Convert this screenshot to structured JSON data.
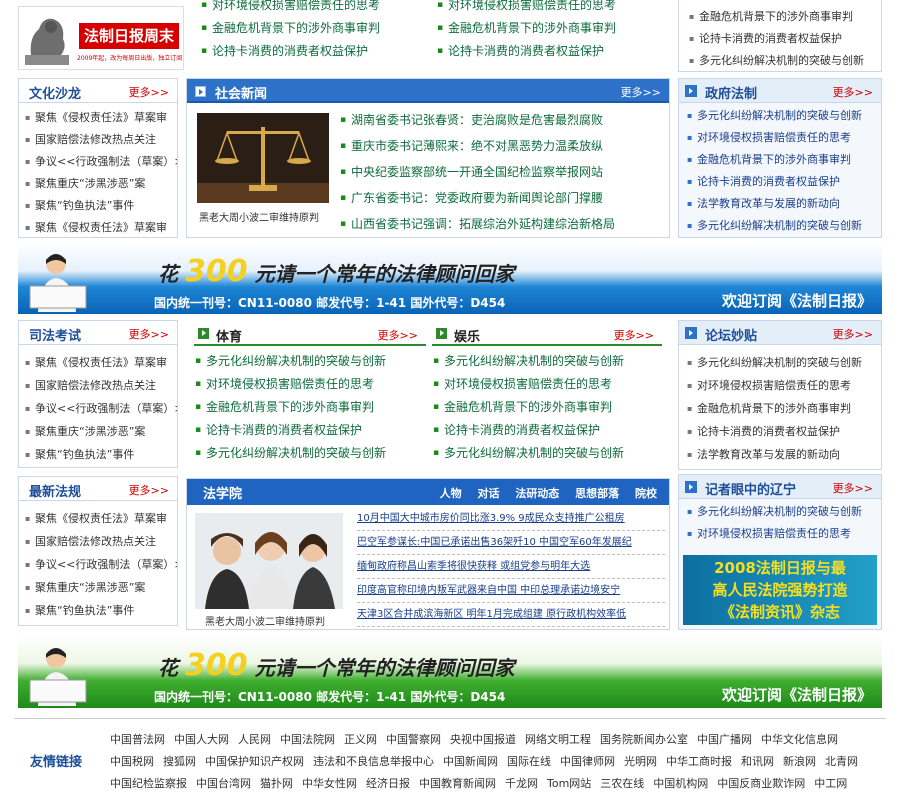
{
  "logo": {
    "text": "法制日报周末",
    "sub": "2009年起，改为每周日出版，独立订阅"
  },
  "top_lists": {
    "col1": [
      "对环境侵权损害赔偿责任的思考",
      "金融危机背景下的涉外商事审判",
      "论持卡消费的消费者权益保护"
    ],
    "col2": [
      "对环境侵权损害赔偿责任的思考",
      "金融危机背景下的涉外商事审判",
      "论持卡消费的消费者权益保护"
    ],
    "col3": [
      "金融危机背景下的涉外商事审判",
      "论持卡消费的消费者权益保护",
      "多元化纠纷解决机制的突破与创新"
    ]
  },
  "wenhua": {
    "title": "文化沙龙",
    "more": "更多>>",
    "items": [
      "聚焦《侵权责任法》草案审",
      "国家赔偿法修改热点关注",
      "争议<<行政强制法（草案）>>",
      "聚焦重庆“涉黑涉恶”案",
      "聚焦“钓鱼执法”事件",
      "聚焦《侵权责任法》草案审"
    ]
  },
  "shehui": {
    "title": "社会新闻",
    "more": "更多>>",
    "caption": "黑老大周小波二审维持原判",
    "items": [
      "湖南省委书记张春贤：吏治腐败是危害最烈腐败",
      "重庆市委书记薄熙来：绝不对黑恶势力温柔放纵",
      "中央纪委监察部统一开通全国纪检监察举报网站",
      "广东省委书记：党委政府要为新闻舆论部门撑腰",
      "山西省委书记强调：拓展综治外延构建综治新格局"
    ]
  },
  "zhengfu": {
    "title": "政府法制",
    "more": "更多>>",
    "items": [
      "多元化纠纷解决机制的突破与创新",
      "对环境侵权损害赔偿责任的思考",
      "金融危机背景下的涉外商事审判",
      "论持卡消费的消费者权益保护",
      "法学教育改革与发展的新动向",
      "多元化纠纷解决机制的突破与创新"
    ]
  },
  "banner": {
    "prefix": "花",
    "num": "300",
    "suffix": "元请一个常年的法律顾问回家",
    "sub": "国内统一刊号：CN11-0080  邮发代号：1-41  国外代号：D454",
    "sub2": "欢迎订阅《法制日报》"
  },
  "sifa": {
    "title": "司法考试",
    "more": "更多>>",
    "items": [
      "聚焦《侵权责任法》草案审",
      "国家赔偿法修改热点关注",
      "争议<<行政强制法（草案）>>",
      "聚焦重庆“涉黑涉恶”案",
      "聚焦“钓鱼执法”事件"
    ]
  },
  "tiyu": {
    "title": "体育",
    "more": "更多>>",
    "items": [
      "多元化纠纷解决机制的突破与创新",
      "对环境侵权损害赔偿责任的思考",
      "金融危机背景下的涉外商事审判",
      "论持卡消费的消费者权益保护",
      "多元化纠纷解决机制的突破与创新"
    ]
  },
  "yule": {
    "title": "娱乐",
    "more": "更多>>",
    "items": [
      "多元化纠纷解决机制的突破与创新",
      "对环境侵权损害赔偿责任的思考",
      "金融危机背景下的涉外商事审判",
      "论持卡消费的消费者权益保护",
      "多元化纠纷解决机制的突破与创新"
    ]
  },
  "luntan": {
    "title": "论坛妙贴",
    "more": "更多>>",
    "items": [
      "多元化纠纷解决机制的突破与创新",
      "对环境侵权损害赔偿责任的思考",
      "金融危机背景下的涉外商事审判",
      "论持卡消费的消费者权益保护",
      "法学教育改革与发展的新动向"
    ]
  },
  "zuixin": {
    "title": "最新法规",
    "more": "更多>>",
    "items": [
      "聚焦《侵权责任法》草案审",
      "国家赔偿法修改热点关注",
      "争议<<行政强制法（草案）>>",
      "聚焦重庆“涉黑涉恶”案",
      "聚焦“钓鱼执法”事件"
    ]
  },
  "fxy": {
    "title": "法学院",
    "tabs": [
      "人物",
      "对话",
      "法研动态",
      "思想部落",
      "院校"
    ],
    "caption": "黑老大周小波二审维持原判",
    "items": [
      "10月中国大中城市房价同比涨3.9% 9成民众支持推广公租房",
      "巴空军参谋长:中国已承诺出售36架歼10 中国空军60年发展纪",
      "缅甸政府称昌山索季将很快获释 或组党参与明年大选",
      "印度高官称印境内叛军武器来自中国 中印总理承诺边境安宁",
      "天津3区合并成滨海新区 明年1月完成组建 原行政机构效率低"
    ]
  },
  "jizhe": {
    "title": "记者眼中的辽宁",
    "more": "更多>>",
    "items": [
      "多元化纠纷解决机制的突破与创新",
      "对环境侵权损害赔偿责任的思考"
    ],
    "ad_line1": "2008法制日报与最",
    "ad_line2": "高人民法院强势打造",
    "ad_line3": "《法制资讯》杂志"
  },
  "links": {
    "label": "友情链接",
    "row1": [
      "中国普法网",
      "中国人大网",
      "人民网",
      "中国法院网",
      "正义网",
      "中国警察网",
      "央视中国报道",
      "网络文明工程",
      "国务院新闻办公室",
      "中国广播网",
      "中华文化信息网"
    ],
    "row2": [
      "中国税网",
      "搜狐网",
      "中国保护知识产权网",
      "违法和不良信息举报中心",
      "中国新闻网",
      "国际在线",
      "中国律师网",
      "光明网",
      "中华工商时报",
      "和讯网",
      "新浪网",
      "北青网"
    ],
    "row3": [
      "中国纪检监察报",
      "中国台湾网",
      "猫扑网",
      "中华女性网",
      "经济日报",
      "中国教育新闻网",
      "千龙网",
      "Tom网站",
      "三农在线",
      "中国机构网",
      "中国反商业欺诈网",
      "中工网"
    ]
  }
}
